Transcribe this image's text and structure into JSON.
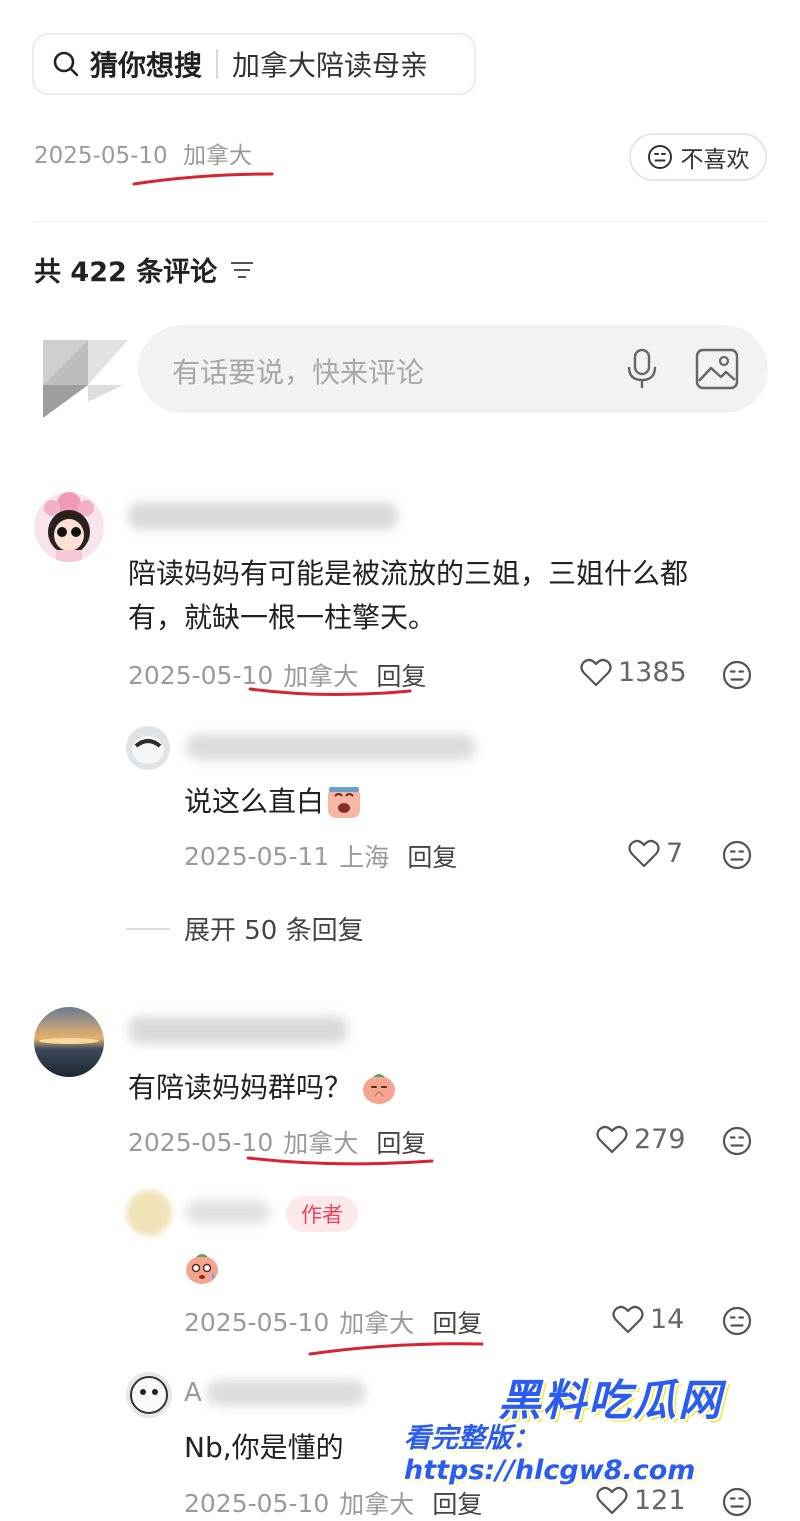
{
  "search": {
    "label": "猜你想搜",
    "query": "加拿大陪读母亲"
  },
  "post_meta": {
    "date": "2025-05-10",
    "location": "加拿大"
  },
  "dislike_label": "不喜欢",
  "comments_header": {
    "prefix": "共",
    "count": "422",
    "suffix": "条评论"
  },
  "input": {
    "placeholder": "有话要说，快来评论"
  },
  "comments": [
    {
      "text_line1": "陪读妈妈有可能是被流放的三姐，三姐什么都",
      "text_line2": "有，就缺一根一柱擎天。",
      "date": "2025-05-10",
      "location": "加拿大",
      "reply_label": "回复",
      "likes": "1385",
      "replies": [
        {
          "text": "说这么直白",
          "date": "2025-05-11",
          "location": "上海",
          "reply_label": "回复",
          "likes": "7"
        }
      ],
      "expand_label": "展开 50 条回复"
    },
    {
      "text": "有陪读妈妈群吗？",
      "date": "2025-05-10",
      "location": "加拿大",
      "reply_label": "回复",
      "likes": "279",
      "replies": [
        {
          "author_tag": "作者",
          "date": "2025-05-10",
          "location": "加拿大",
          "reply_label": "回复",
          "likes": "14"
        },
        {
          "name_initial": "A",
          "text": "Nb,你是懂的",
          "date": "2025-05-10",
          "location": "加拿大",
          "reply_label": "回复",
          "likes": "121"
        }
      ]
    }
  ],
  "watermark": {
    "title": "黑料吃瓜网",
    "line": "看完整版：https://hlcgw8.com"
  },
  "colors": {
    "accent_red": "#d62433",
    "author_tag_bg": "#fde9ec",
    "watermark_blue": "#2a5cf0"
  }
}
